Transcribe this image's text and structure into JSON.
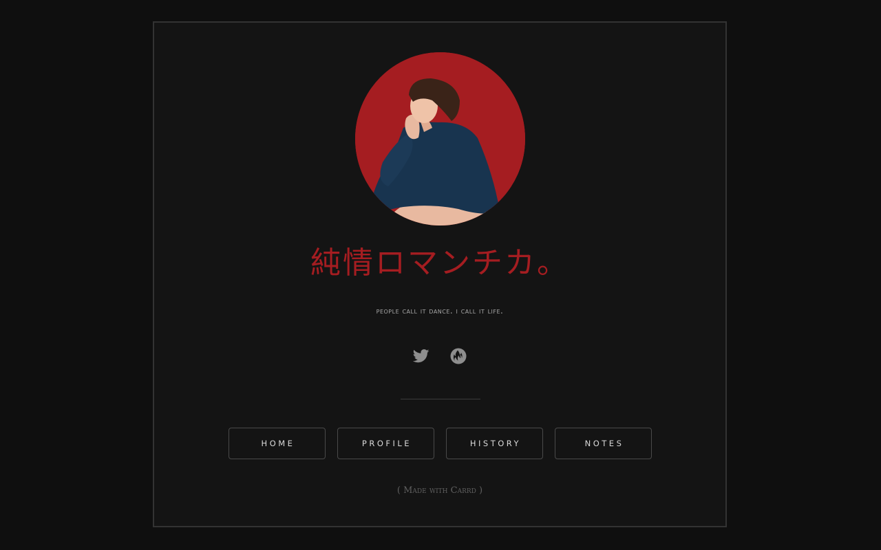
{
  "profile": {
    "avatar_alt": "portrait on red background",
    "title": "純情ロマンチカ。",
    "subtitle": "PEOPLE CALL IT DANCE. I CALL IT LIFE."
  },
  "social": [
    {
      "icon": "twitter-icon"
    },
    {
      "icon": "fire-icon"
    }
  ],
  "nav": {
    "items": [
      "HOME",
      "PROFILE",
      "HISTORY",
      "NOTES"
    ]
  },
  "footer": {
    "open": "( ",
    "link_label": "Made with Carrd",
    "close": " )"
  },
  "colors": {
    "accent": "#a51d21",
    "background": "#0f0f0f",
    "card": "#141414",
    "icon": "#8e8e8e"
  }
}
